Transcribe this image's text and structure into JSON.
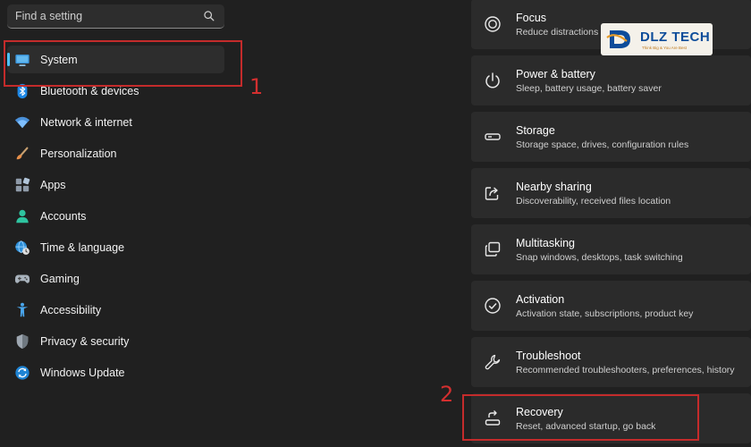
{
  "search": {
    "placeholder": "Find a setting",
    "icon": "search-icon"
  },
  "nav": {
    "items": [
      {
        "label": "System",
        "icon": "monitor-icon",
        "selected": true
      },
      {
        "label": "Bluetooth & devices",
        "icon": "bluetooth-icon"
      },
      {
        "label": "Network & internet",
        "icon": "wifi-icon"
      },
      {
        "label": "Personalization",
        "icon": "brush-icon"
      },
      {
        "label": "Apps",
        "icon": "apps-icon"
      },
      {
        "label": "Accounts",
        "icon": "person-icon"
      },
      {
        "label": "Time & language",
        "icon": "globe-clock-icon"
      },
      {
        "label": "Gaming",
        "icon": "gamepad-icon"
      },
      {
        "label": "Accessibility",
        "icon": "accessibility-icon"
      },
      {
        "label": "Privacy & security",
        "icon": "shield-icon"
      },
      {
        "label": "Windows Update",
        "icon": "update-icon"
      }
    ]
  },
  "cards": [
    {
      "title": "Focus",
      "subtitle": "Reduce distractions",
      "icon": "focus-icon"
    },
    {
      "title": "Power & battery",
      "subtitle": "Sleep, battery usage, battery saver",
      "icon": "power-icon"
    },
    {
      "title": "Storage",
      "subtitle": "Storage space, drives, configuration rules",
      "icon": "storage-icon"
    },
    {
      "title": "Nearby sharing",
      "subtitle": "Discoverability, received files location",
      "icon": "share-icon"
    },
    {
      "title": "Multitasking",
      "subtitle": "Snap windows, desktops, task switching",
      "icon": "multitasking-icon"
    },
    {
      "title": "Activation",
      "subtitle": "Activation state, subscriptions, product key",
      "icon": "check-circle-icon"
    },
    {
      "title": "Troubleshoot",
      "subtitle": "Recommended troubleshooters, preferences, history",
      "icon": "wrench-icon"
    },
    {
      "title": "Recovery",
      "subtitle": "Reset, advanced startup, go back",
      "icon": "recovery-icon"
    }
  ],
  "annotations": {
    "step1": "1",
    "step2": "2"
  },
  "watermark": {
    "brand": "DLZ TECH",
    "tagline": "Think Big & You Are Best"
  },
  "colors": {
    "accent": "#4cc2ff",
    "highlight": "#c42b2b",
    "background": "#202020",
    "card": "#2b2b2b"
  }
}
